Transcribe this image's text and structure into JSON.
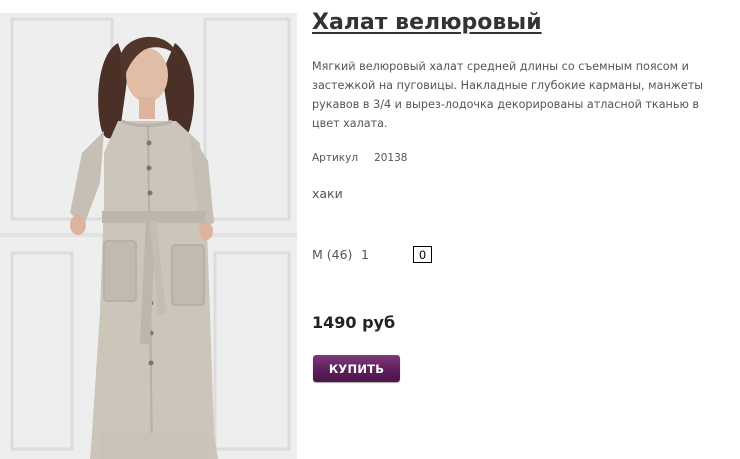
{
  "product": {
    "title": "Халат велюровый",
    "description": "Мягкий велюровый халат средней длины со съемным поясом и застежкой на пуговицы. Накладные глубокие карманы, манжеты рукавов в 3/4 и вырез-лодочка декорированы атласной тканью в цвет халата.",
    "sku_label": "Артикул",
    "sku_value": "20138",
    "color": "хаки",
    "size_label": "M (46)",
    "stock": "1",
    "quantity": "0",
    "price": "1490 руб",
    "buy_label": "КУПИТЬ"
  },
  "colors": {
    "button": "#5f1f5c",
    "text": "#555555",
    "title": "#333333"
  }
}
